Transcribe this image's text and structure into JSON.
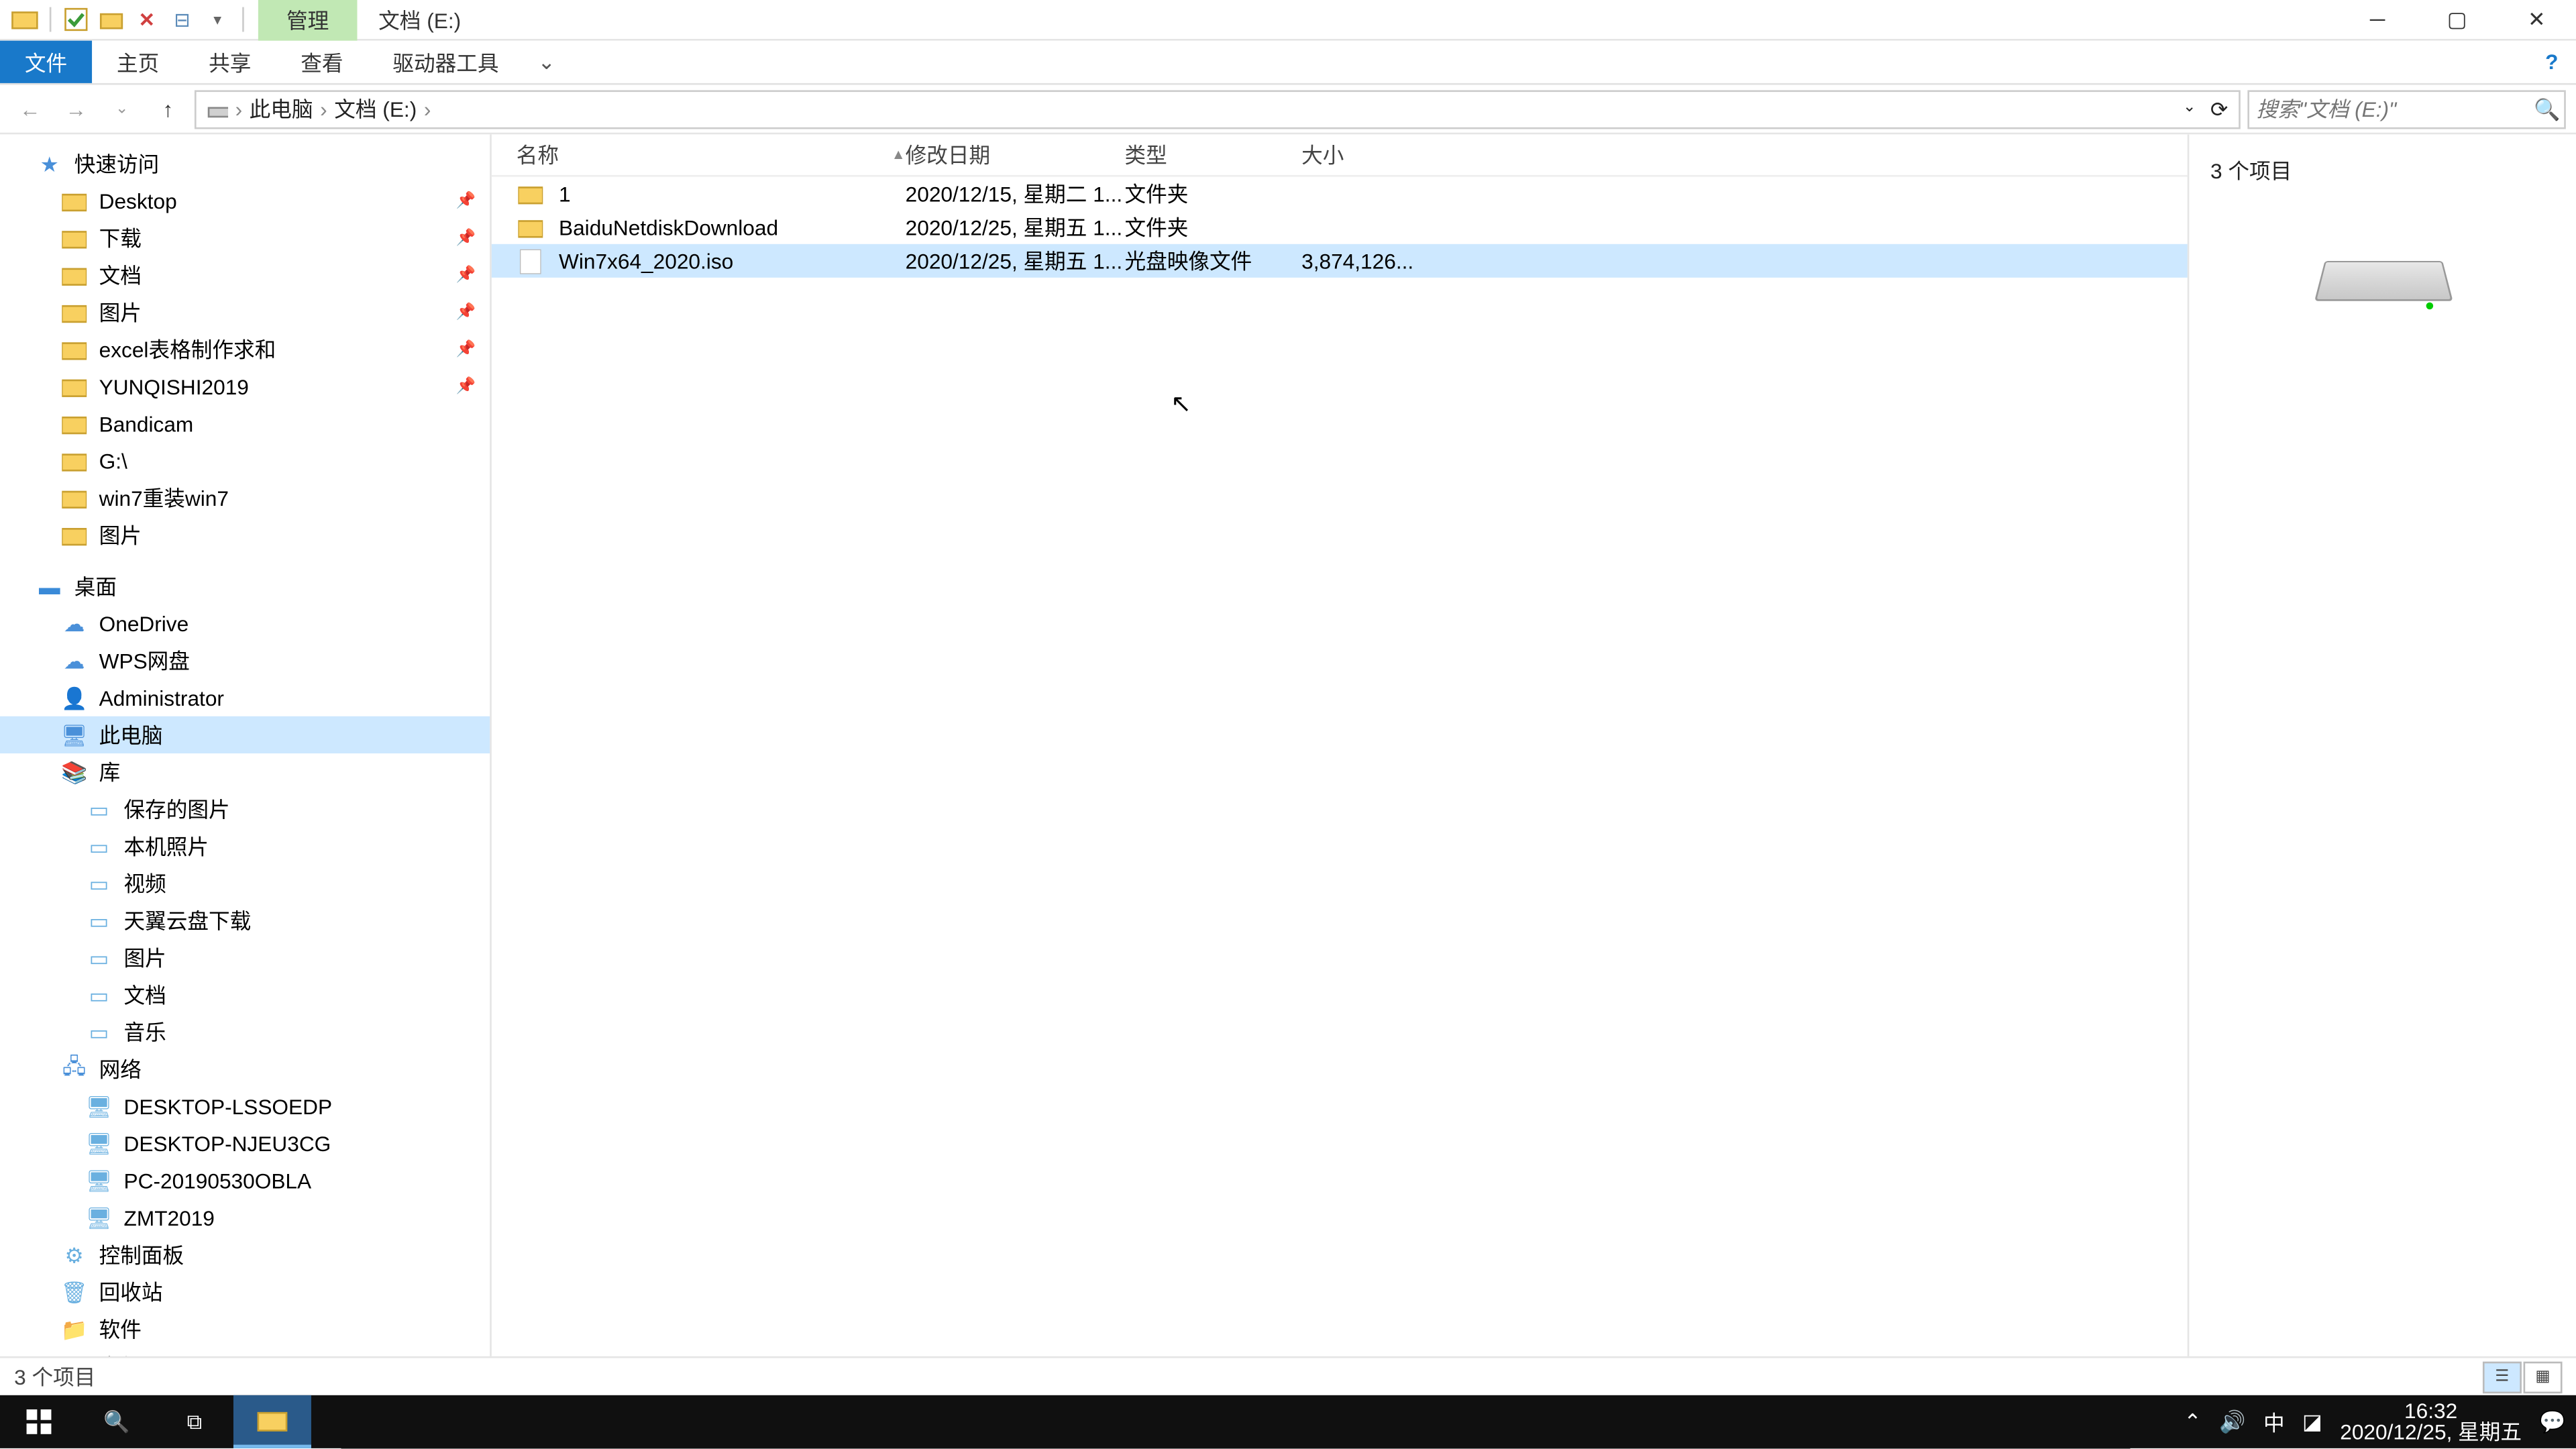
{
  "title": {
    "context_tab": "管理",
    "location": "文档 (E:)"
  },
  "ribbon": {
    "file": "文件",
    "home": "主页",
    "share": "共享",
    "view": "查看",
    "drive": "驱动器工具"
  },
  "breadcrumb": {
    "pc": "此电脑",
    "drive": "文档 (E:)"
  },
  "search": {
    "placeholder": "搜索\"文档 (E:)\""
  },
  "nav": {
    "quick": "快速访问",
    "quick_items": [
      {
        "l": "Desktop",
        "pin": true
      },
      {
        "l": "下载",
        "pin": true
      },
      {
        "l": "文档",
        "pin": true
      },
      {
        "l": "图片",
        "pin": true
      },
      {
        "l": "excel表格制作求和",
        "pin": true
      },
      {
        "l": "YUNQISHI2019",
        "pin": true
      },
      {
        "l": "Bandicam"
      },
      {
        "l": "G:\\"
      },
      {
        "l": "win7重装win7"
      },
      {
        "l": "图片"
      }
    ],
    "desktop": "桌面",
    "desktop_items": [
      "OneDrive",
      "WPS网盘",
      "Administrator",
      "此电脑",
      "库"
    ],
    "lib_items": [
      "保存的图片",
      "本机照片",
      "视频",
      "天翼云盘下载",
      "图片",
      "文档",
      "音乐"
    ],
    "network": "网络",
    "net_items": [
      "DESKTOP-LSSOEDP",
      "DESKTOP-NJEU3CG",
      "PC-20190530OBLA",
      "ZMT2019"
    ],
    "others": [
      "控制面板",
      "回收站",
      "软件",
      "文件"
    ]
  },
  "columns": {
    "name": "名称",
    "date": "修改日期",
    "type": "类型",
    "size": "大小"
  },
  "files": [
    {
      "name": "1",
      "date": "2020/12/15, 星期二 1...",
      "type": "文件夹",
      "size": "",
      "icon": "folder"
    },
    {
      "name": "BaiduNetdiskDownload",
      "date": "2020/12/25, 星期五 1...",
      "type": "文件夹",
      "size": "",
      "icon": "folder"
    },
    {
      "name": "Win7x64_2020.iso",
      "date": "2020/12/25, 星期五 1...",
      "type": "光盘映像文件",
      "size": "3,874,126...",
      "icon": "file",
      "selected": true
    }
  ],
  "preview": {
    "count": "3 个项目"
  },
  "status": {
    "text": "3 个项目"
  },
  "tray": {
    "time": "16:32",
    "date": "2020/12/25, 星期五",
    "ime": "中"
  }
}
